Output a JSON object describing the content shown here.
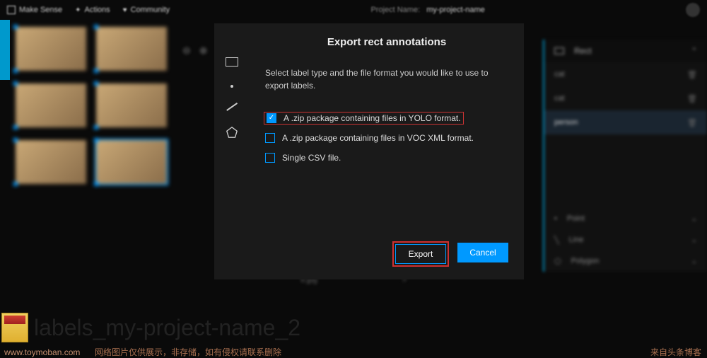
{
  "topbar": {
    "brand": "Make Sense",
    "menu_actions": "Actions",
    "menu_community": "Community",
    "project_label": "Project Name:",
    "project_value": "my-project-name"
  },
  "right_panel": {
    "header": "Rect",
    "labels": [
      "cat",
      "cat",
      "person"
    ],
    "footer": [
      "Point",
      "Line",
      "Polygon"
    ]
  },
  "bottom": {
    "filename": "9.jpg",
    "arrow": ">"
  },
  "modal": {
    "title": "Export rect annotations",
    "description": "Select label type and the file format you would like to use to export labels.",
    "options": [
      {
        "label": "A .zip package containing files in YOLO format.",
        "checked": true,
        "highlighted": true
      },
      {
        "label": "A .zip package containing files in VOC XML format.",
        "checked": false,
        "highlighted": false
      },
      {
        "label": "Single CSV file.",
        "checked": false,
        "highlighted": false
      }
    ],
    "export_btn": "Export",
    "cancel_btn": "Cancel"
  },
  "file": {
    "name": "labels_my-project-name_2"
  },
  "watermarks": {
    "w1": "www.toymoban.com",
    "w2": "网络图片仅供展示，非存储，如有侵权请联系删除",
    "w3": "来自头条博客"
  }
}
